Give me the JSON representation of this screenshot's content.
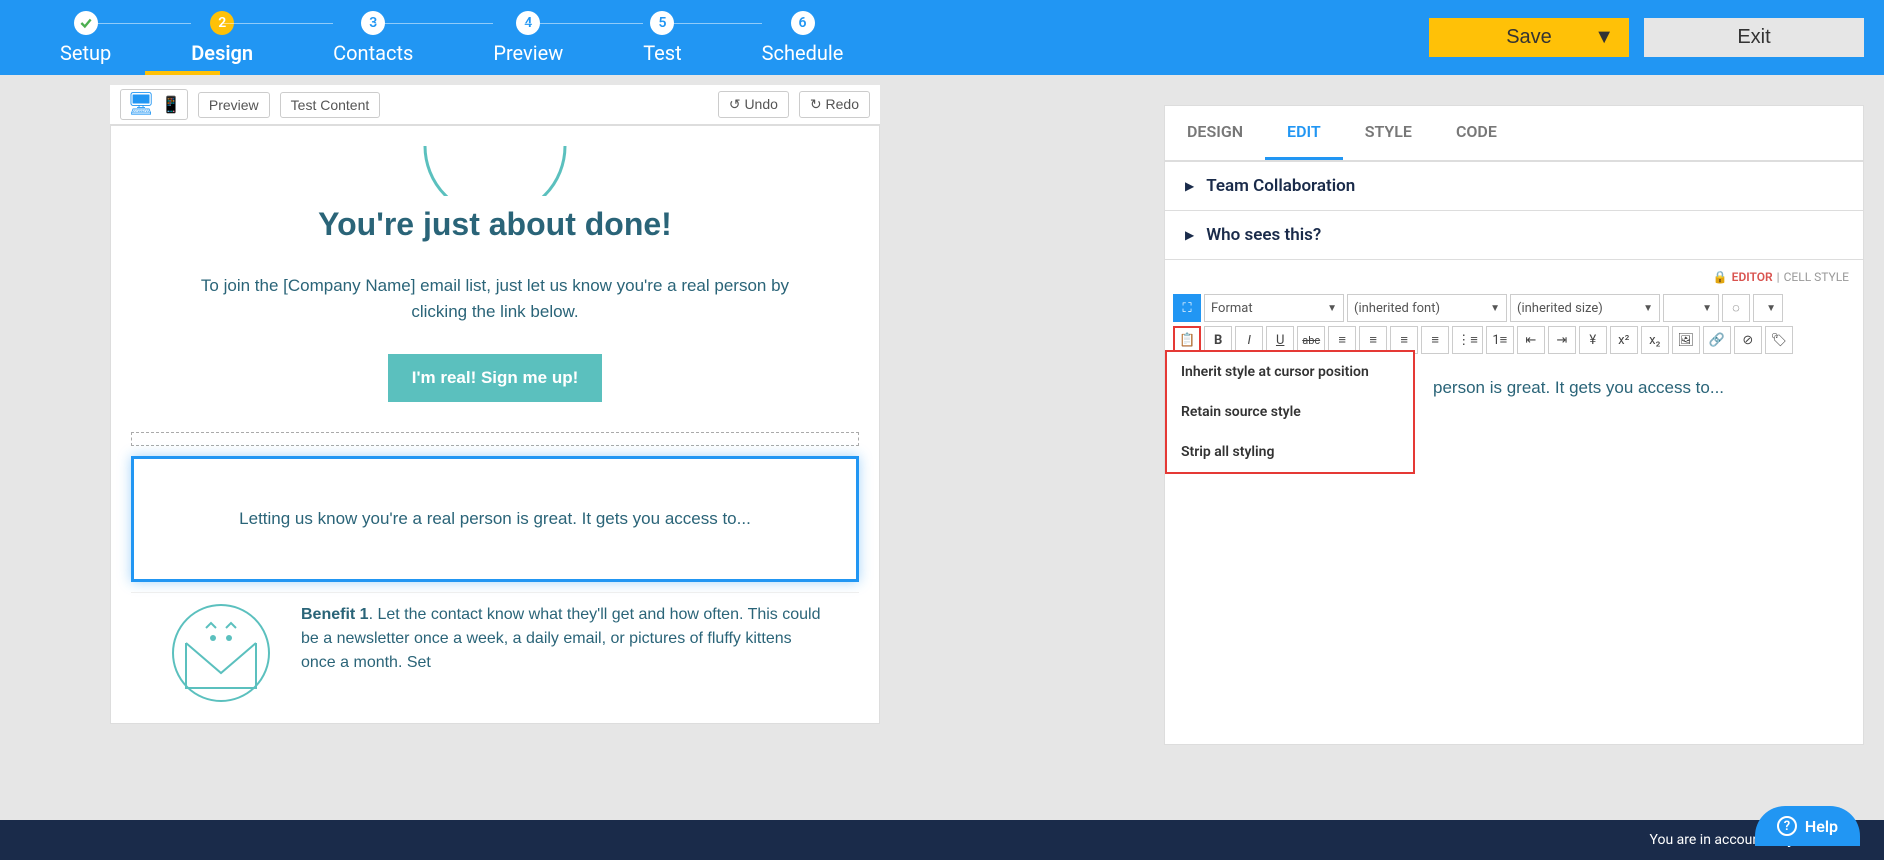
{
  "steps": [
    {
      "num": "✓",
      "label": "Setup",
      "state": "done"
    },
    {
      "num": "2",
      "label": "Design",
      "state": "active"
    },
    {
      "num": "3",
      "label": "Contacts",
      "state": ""
    },
    {
      "num": "4",
      "label": "Preview",
      "state": ""
    },
    {
      "num": "5",
      "label": "Test",
      "state": ""
    },
    {
      "num": "6",
      "label": "Schedule",
      "state": ""
    }
  ],
  "topbar": {
    "save": "Save",
    "exit": "Exit"
  },
  "canvas_toolbar": {
    "preview": "Preview",
    "test_content": "Test Content",
    "undo": "Undo",
    "redo": "Redo"
  },
  "email": {
    "heading": "You're just about done!",
    "intro": "To join the [Company Name] email list, just let us know you're a real person by clicking the link below.",
    "cta": "I'm real! Sign me up!",
    "selected_text": "Letting us know you're a real person is great. It gets you access to...",
    "benefit_title": "Benefit 1",
    "benefit_body": ". Let the contact know what they'll get and how often. This could be a newsletter once a week, a daily email, or pictures of fluffy kittens once a month. Set"
  },
  "panel": {
    "tabs": {
      "design": "DESIGN",
      "edit": "EDIT",
      "style": "STYLE",
      "code": "CODE"
    },
    "accordion": {
      "team": "Team Collaboration",
      "who": "Who sees this?"
    },
    "breadcrumb": {
      "editor": "EDITOR",
      "cell_style": "CELL STYLE"
    },
    "fmt": {
      "format": "Format",
      "font": "(inherited font)",
      "size": "(inherited size)",
      "currency": "¥"
    },
    "paste_menu": {
      "inherit": "Inherit style at cursor position",
      "retain": "Retain source style",
      "strip": "Strip all styling"
    },
    "editor_text": "person is great. It gets you access to..."
  },
  "footer": {
    "prefix": "You are in account: ",
    "account": "Yay Software"
  },
  "help": "Help"
}
